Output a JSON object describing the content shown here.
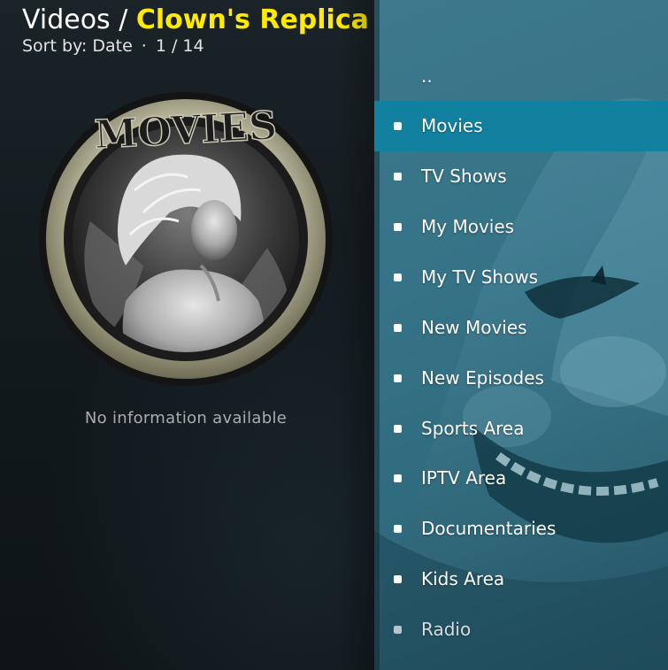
{
  "header": {
    "section": "Videos",
    "separator": " / ",
    "addon_name": "Clown's Replica",
    "sort_label": "Sort by: Date",
    "sep_dot": "·",
    "position": "1 / 14"
  },
  "poster": {
    "logo_text": "MOVIES"
  },
  "info": {
    "message": "No information available"
  },
  "colors": {
    "accent_title": "#ffea00",
    "selection": "#12809f"
  },
  "list": {
    "parent_label": "..",
    "items": [
      {
        "label": "Movies",
        "icon": "bullet-icon"
      },
      {
        "label": "TV Shows",
        "icon": "bullet-icon"
      },
      {
        "label": "My Movies",
        "icon": "bullet-icon"
      },
      {
        "label": "My TV Shows",
        "icon": "bullet-icon"
      },
      {
        "label": "New Movies",
        "icon": "bullet-icon"
      },
      {
        "label": "New Episodes",
        "icon": "bullet-icon"
      },
      {
        "label": "Sports Area",
        "icon": "bullet-icon"
      },
      {
        "label": "IPTV Area",
        "icon": "bullet-icon"
      },
      {
        "label": "Documentaries",
        "icon": "bullet-icon"
      },
      {
        "label": "Kids Area",
        "icon": "bullet-icon"
      },
      {
        "label": "Radio",
        "icon": "bullet-icon"
      }
    ],
    "selected_index": 0
  }
}
